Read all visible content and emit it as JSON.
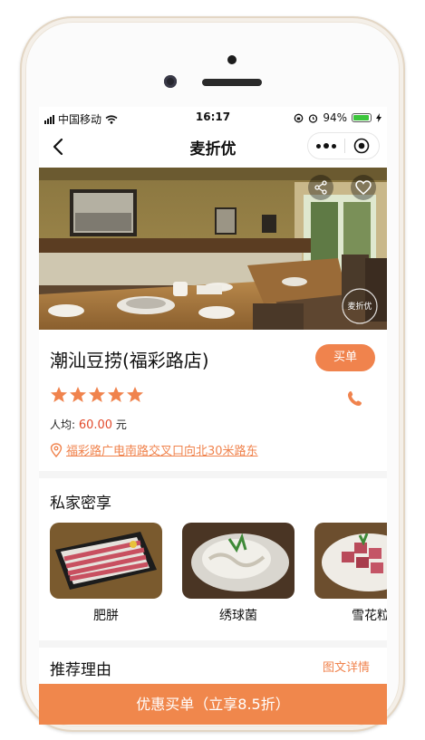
{
  "status_bar": {
    "carrier": "中国移动",
    "time": "16:17",
    "battery": "94%",
    "battery_level": 0.94
  },
  "navbar": {
    "title": "麦折优"
  },
  "hero": {
    "watermark": "麦折优"
  },
  "restaurant": {
    "name": "潮汕豆捞(福彩路店)",
    "buy_label": "买单",
    "rating": 5,
    "avg_label": "人均: ",
    "avg_price": "60.00",
    "avg_unit": " 元",
    "address": "福彩路广电南路交叉口向北30米路东"
  },
  "private_section": {
    "title": "私家密享",
    "dishes": [
      {
        "name": "肥胼"
      },
      {
        "name": "绣球菌"
      },
      {
        "name": "雪花粒"
      }
    ]
  },
  "recommend_section": {
    "title": "推荐理由",
    "detail_link": "图文详情"
  },
  "bottom_button": {
    "label": "优惠买单（立享8.5折）"
  },
  "colors": {
    "accent": "#f0834d",
    "price": "#e24a2c"
  },
  "icons": [
    "back-icon",
    "more-icon",
    "close-circle-icon",
    "share-icon",
    "heart-icon",
    "star-icon",
    "phone-icon",
    "location-icon"
  ]
}
